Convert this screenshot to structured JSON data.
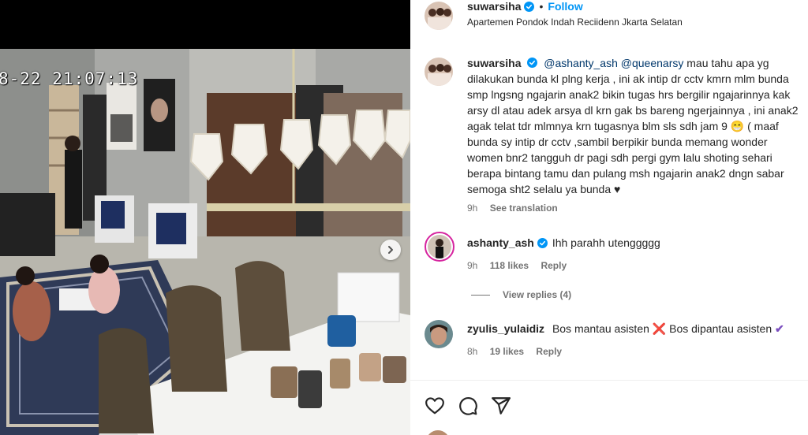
{
  "post": {
    "username": "suwarsiha",
    "separator": "•",
    "follow_label": "Follow",
    "location": "Apartemen Pondok Indah Reciidenn Jkarta Selatan",
    "cctv_timestamp": "8-22  21:07:13"
  },
  "caption": {
    "username": "suwarsiha",
    "mentions": [
      "@ashanty_ash",
      "@queenarsy"
    ],
    "text": " mau tahu apa yg dilakukan bunda kl plng kerja , ini ak intip dr cctv kmrn mlm bunda smp lngsng ngajarin anak2 bikin tugas hrs bergilir ngajarinnya kak arsy dl atau adek arsya dl krn gak bs bareng ngerjainnya , ini anak2 agak telat tdr mlmnya krn tugasnya blm sls sdh jam 9 😁 ( maaf bunda sy intip dr cctv ,sambil berpikir bunda memang wonder women bnr2 tangguh dr pagi sdh pergi gym lalu shoting sehari berapa bintang tamu dan pulang msh ngajarin anak2 dngn sabar semoga sht2 selalu ya bunda ♥",
    "time": "9h",
    "see_translation": "See translation"
  },
  "comments": [
    {
      "username": "ashanty_ash",
      "verified": true,
      "text": "Ihh parahh utenggggg",
      "time": "9h",
      "likes": "118 likes",
      "reply_label": "Reply",
      "view_replies": "View replies (4)"
    },
    {
      "username": "zyulis_yulaidiz",
      "verified": false,
      "text_part1": "Bos mantau asisten ",
      "mark1": "❌",
      "text_part2": " Bos dipantau asisten ",
      "mark2": "✔",
      "time": "8h",
      "likes": "19 likes",
      "reply_label": "Reply"
    }
  ],
  "icons": {
    "verified": "verified-badge-icon",
    "like": "heart-icon",
    "comment": "comment-bubble-icon",
    "share": "paper-plane-icon",
    "carousel_next": "chevron-right-icon"
  },
  "colors": {
    "accent_blue": "#0095f6",
    "mention": "#00376b",
    "muted": "#737373",
    "story_ring": "#d6249f"
  }
}
